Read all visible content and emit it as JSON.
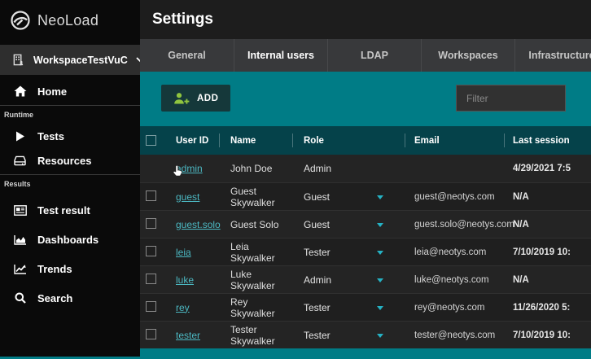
{
  "sidebar": {
    "logo_text": "NeoLoad",
    "workspace_label": "WorkspaceTestVuC",
    "home_label": "Home",
    "runtime_section_label": "Runtime",
    "tests_label": "Tests",
    "resources_label": "Resources",
    "results_section_label": "Results",
    "test_result_label": "Test result",
    "dashboards_label": "Dashboards",
    "trends_label": "Trends",
    "search_label": "Search"
  },
  "header": {
    "title": "Settings"
  },
  "tabs": [
    {
      "label": "General",
      "active": false
    },
    {
      "label": "Internal users",
      "active": true
    },
    {
      "label": "LDAP",
      "active": false
    },
    {
      "label": "Workspaces",
      "active": false
    },
    {
      "label": "Infrastructure",
      "active": false
    }
  ],
  "toolbar": {
    "add_label": "ADD",
    "filter_placeholder": "Filter"
  },
  "table": {
    "columns": [
      "User ID",
      "Name",
      "Role",
      "Email",
      "Last session"
    ],
    "rows": [
      {
        "user_id": "admin",
        "name": "John Doe",
        "role": "Admin",
        "email": "",
        "last_session": "4/29/2021 7:5",
        "has_checkbox": false,
        "role_editable": false,
        "cursor_overlay": true
      },
      {
        "user_id": "guest",
        "name": "Guest Skywalker",
        "role": "Guest",
        "email": "guest@neotys.com",
        "last_session": "N/A",
        "has_checkbox": true,
        "role_editable": true,
        "cursor_overlay": false
      },
      {
        "user_id": "guest.solo",
        "name": "Guest Solo",
        "role": "Guest",
        "email": "guest.solo@neotys.com",
        "last_session": "N/A",
        "has_checkbox": true,
        "role_editable": true,
        "cursor_overlay": false
      },
      {
        "user_id": "leia",
        "name": "Leia Skywalker",
        "role": "Tester",
        "email": "leia@neotys.com",
        "last_session": "7/10/2019 10:",
        "has_checkbox": true,
        "role_editable": true,
        "cursor_overlay": false
      },
      {
        "user_id": "luke",
        "name": "Luke Skywalker",
        "role": "Admin",
        "email": "luke@neotys.com",
        "last_session": "N/A",
        "has_checkbox": true,
        "role_editable": true,
        "cursor_overlay": false
      },
      {
        "user_id": "rey",
        "name": "Rey Skywalker",
        "role": "Tester",
        "email": "rey@neotys.com",
        "last_session": "11/26/2020 5:",
        "has_checkbox": true,
        "role_editable": true,
        "cursor_overlay": false
      },
      {
        "user_id": "tester",
        "name": "Tester Skywalker",
        "role": "Tester",
        "email": "tester@neotys.com",
        "last_session": "7/10/2019 10:",
        "has_checkbox": true,
        "role_editable": true,
        "cursor_overlay": false
      }
    ]
  },
  "colors": {
    "content_teal": "#007c86",
    "table_header_teal": "#05424a",
    "link_teal": "#4cb8c2",
    "caret_teal": "#25b2c4",
    "add_icon_green": "#90c53f",
    "header_dark": "#1d1d1d",
    "tabs_gray": "#38393b",
    "sidebar_black": "#0a0a0a"
  }
}
